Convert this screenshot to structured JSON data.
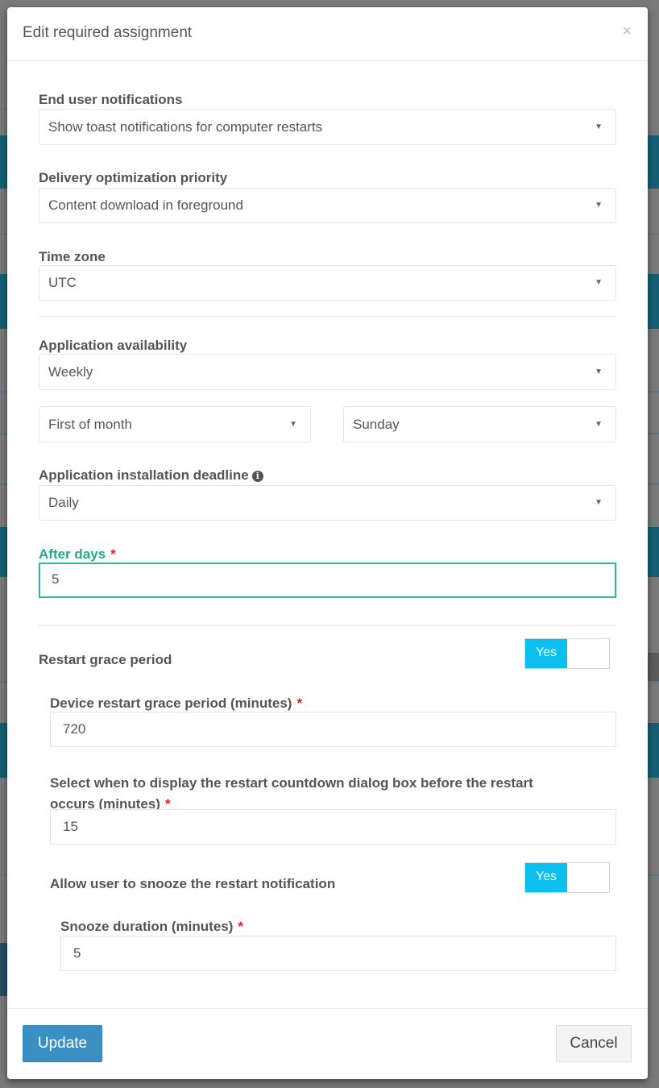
{
  "modal": {
    "title": "Edit required assignment",
    "close_icon": "×"
  },
  "fields": {
    "end_user_notifications": {
      "label": "End user notifications",
      "value": "Show toast notifications for computer restarts"
    },
    "delivery_optimization": {
      "label": "Delivery optimization priority",
      "value": "Content download in foreground"
    },
    "time_zone": {
      "label": "Time zone",
      "value": "UTC"
    },
    "app_availability": {
      "label": "Application availability",
      "value": "Weekly",
      "week_value": "First of month",
      "day_value": "Sunday"
    },
    "install_deadline": {
      "label": "Application installation deadline",
      "info_icon": "i",
      "value": "Daily"
    },
    "after_days": {
      "label": "After days",
      "required": "*",
      "value": "5"
    },
    "restart_grace": {
      "label": "Restart grace period",
      "toggle": "Yes",
      "enabled": true
    },
    "device_grace_minutes": {
      "label": "Device restart grace period (minutes)",
      "required": "*",
      "value": "720"
    },
    "countdown_minutes": {
      "label_line1": "Select when to display the restart countdown dialog box before the restart",
      "label_line2": "occurs (minutes)",
      "required": "*",
      "value": "15"
    },
    "allow_snooze": {
      "label": "Allow user to snooze the restart notification",
      "toggle": "Yes",
      "enabled": true
    },
    "snooze_duration": {
      "label": "Snooze duration (minutes)",
      "required": "*",
      "value": "5"
    }
  },
  "footer": {
    "update_label": "Update",
    "cancel_label": "Cancel"
  },
  "caret_glyph": "▼",
  "colors": {
    "accent_green": "#26a98b",
    "toggle_on": "#0bbfee",
    "primary_button": "#3a8fc3",
    "required": "#e02020"
  }
}
